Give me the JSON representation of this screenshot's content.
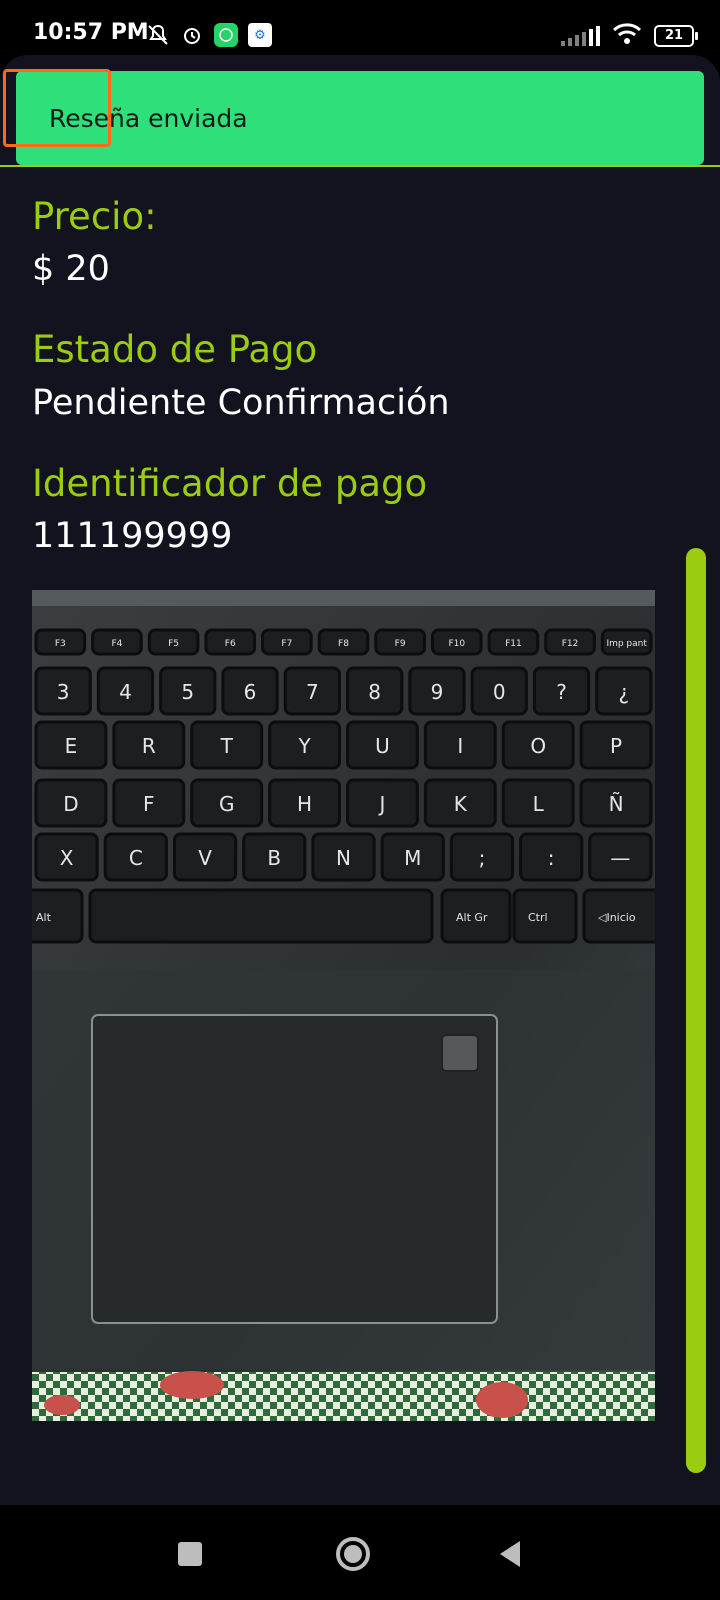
{
  "status_bar": {
    "time": "10:57 PM",
    "battery": "21"
  },
  "toast": {
    "message": "Reseña enviada"
  },
  "details": {
    "price_label": "Precio:",
    "price_value": "$ 20",
    "payment_status_label": "Estado de Pago",
    "payment_status_value": "Pendiente Confirmación",
    "payment_id_label": "Identificador de pago",
    "payment_id_value": "111199999"
  },
  "keyboard_rows": [
    [
      "F3",
      "F4",
      "F5",
      "F6",
      "F7",
      "F8",
      "F9",
      "F10",
      "F11",
      "F12",
      "Imp pant"
    ],
    [
      "3",
      "4",
      "5",
      "6",
      "7",
      "8",
      "9",
      "0",
      "?",
      "¿"
    ],
    [
      "E",
      "R",
      "T",
      "Y",
      "U",
      "I",
      "O",
      "P"
    ],
    [
      "D",
      "F",
      "G",
      "H",
      "J",
      "K",
      "L",
      "Ñ"
    ],
    [
      "X",
      "C",
      "V",
      "B",
      "N",
      "M",
      ";",
      ":",
      "—"
    ],
    [
      "Alt",
      "Alt Gr",
      "Ctrl",
      "◁Inicio"
    ]
  ],
  "colors": {
    "accent": "#9acc10",
    "toast": "#2fdf7a",
    "background": "#131320",
    "focus": "#ff6a18"
  },
  "icons": {
    "status": [
      "silent-icon",
      "alarm-icon",
      "whatsapp-icon",
      "app-icon"
    ],
    "nav": [
      "recents-icon",
      "home-icon",
      "back-icon"
    ]
  }
}
